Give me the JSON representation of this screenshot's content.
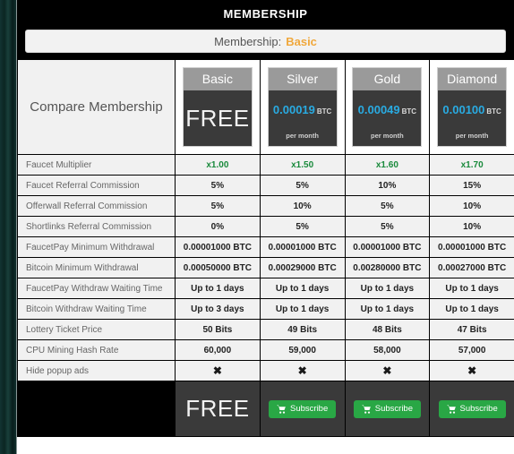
{
  "background": {
    "accent_dark": "#0d2420"
  },
  "header": {
    "title": "MEMBERSHIP",
    "membership_label": "Membership:",
    "membership_value": "Basic",
    "membership_value_color": "#f0a83c"
  },
  "table": {
    "compare_label": "Compare Membership",
    "tiers": [
      {
        "name": "Basic",
        "price": "FREE",
        "currency": "",
        "period": "",
        "is_free": true,
        "cta": ""
      },
      {
        "name": "Silver",
        "price": "0.00019",
        "currency": "BTC",
        "period": "per month",
        "is_free": false,
        "cta": "Subscribe"
      },
      {
        "name": "Gold",
        "price": "0.00049",
        "currency": "BTC",
        "period": "per month",
        "is_free": false,
        "cta": "Subscribe"
      },
      {
        "name": "Diamond",
        "price": "0.00100",
        "currency": "BTC",
        "period": "per month",
        "is_free": false,
        "cta": "Subscribe"
      }
    ],
    "rows": [
      {
        "label": "Faucet Multiplier",
        "style": "mult",
        "values": [
          "x1.00",
          "x1.50",
          "x1.60",
          "x1.70"
        ]
      },
      {
        "label": "Faucet Referral Commission",
        "style": "",
        "values": [
          "5%",
          "5%",
          "10%",
          "15%"
        ]
      },
      {
        "label": "Offerwall Referral Commission",
        "style": "",
        "values": [
          "5%",
          "10%",
          "5%",
          "10%"
        ]
      },
      {
        "label": "Shortlinks Referral Commission",
        "style": "",
        "values": [
          "0%",
          "5%",
          "5%",
          "10%"
        ]
      },
      {
        "label": "FaucetPay Minimum Withdrawal",
        "style": "",
        "values": [
          "0.00001000 BTC",
          "0.00001000 BTC",
          "0.00001000 BTC",
          "0.00001000 BTC"
        ]
      },
      {
        "label": "Bitcoin Minimum Withdrawal",
        "style": "",
        "values": [
          "0.00050000 BTC",
          "0.00029000 BTC",
          "0.00280000 BTC",
          "0.00027000 BTC"
        ]
      },
      {
        "label": "FaucetPay Withdraw Waiting Time",
        "style": "",
        "values": [
          "Up to 1 days",
          "Up to 1 days",
          "Up to 1 days",
          "Up to 1 days"
        ]
      },
      {
        "label": "Bitcoin Withdraw Waiting Time",
        "style": "",
        "values": [
          "Up to 3 days",
          "Up to 1 days",
          "Up to 1 days",
          "Up to 1 days"
        ]
      },
      {
        "label": "Lottery Ticket Price",
        "style": "",
        "values": [
          "50 Bits",
          "49 Bits",
          "48 Bits",
          "47 Bits"
        ]
      },
      {
        "label": "CPU Mining Hash Rate",
        "style": "",
        "values": [
          "60,000",
          "59,000",
          "58,000",
          "57,000"
        ]
      },
      {
        "label": "Hide popup ads",
        "style": "icon",
        "values": [
          "✖",
          "✖",
          "✖",
          "✖"
        ]
      }
    ]
  },
  "colors": {
    "price_accent": "#29abe2",
    "multiplier_green": "#1a8a3c",
    "subscribe_green": "#29a745"
  }
}
